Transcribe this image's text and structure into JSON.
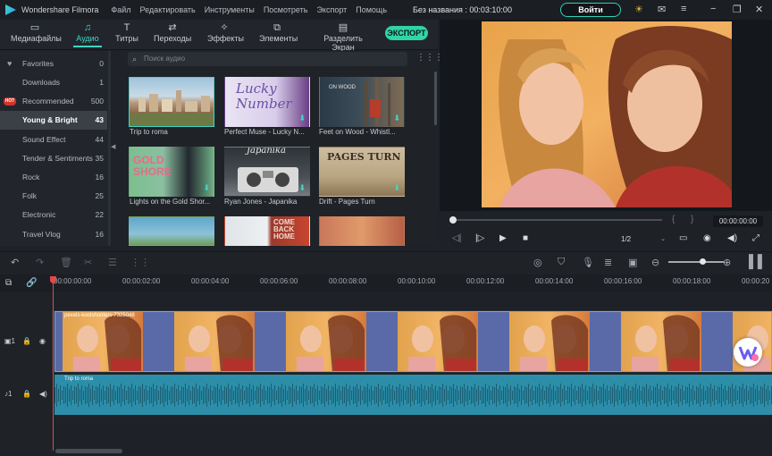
{
  "app": {
    "name": "Wondershare Filmora",
    "project": "Без названия : 00:03:10:00",
    "login": "Войти"
  },
  "menu": [
    "Файл",
    "Редактировать",
    "Инструменты",
    "Посмотреть",
    "Экспорт",
    "Помощь"
  ],
  "tabs": [
    {
      "label": "Медиафайлы",
      "icon": "folder-icon"
    },
    {
      "label": "Аудио",
      "icon": "music-note-icon",
      "active": true
    },
    {
      "label": "Титры",
      "icon": "text-icon"
    },
    {
      "label": "Переходы",
      "icon": "transition-icon"
    },
    {
      "label": "Эффекты",
      "icon": "effects-icon"
    },
    {
      "label": "Элементы",
      "icon": "elements-icon"
    },
    {
      "label": "Разделить Экран",
      "icon": "split-screen-icon"
    }
  ],
  "export_label": "ЭКСПОРТ",
  "sidebar": [
    {
      "label": "Favorites",
      "count": "0"
    },
    {
      "label": "Downloads",
      "count": "1"
    },
    {
      "label": "Recommended",
      "count": "500",
      "badge": "HOT"
    },
    {
      "label": "Young & Bright",
      "count": "43"
    },
    {
      "label": "Sound Effect",
      "count": "44"
    },
    {
      "label": "Tender & Sentiments",
      "count": "35"
    },
    {
      "label": "Rock",
      "count": "16"
    },
    {
      "label": "Folk",
      "count": "25"
    },
    {
      "label": "Electronic",
      "count": "22"
    },
    {
      "label": "Travel Vlog",
      "count": "16"
    }
  ],
  "search_placeholder": "Поиск аудио",
  "audio_items": [
    {
      "title": "Trip to roma"
    },
    {
      "title": "Perfect Muse - Lucky N...",
      "art_text": "Lucky Number"
    },
    {
      "title": "Feet on Wood - Whistl...",
      "art_text": "ON WOOD"
    },
    {
      "title": "Lights on the Gold Shor...",
      "art_text": "GOLD SHORE"
    },
    {
      "title": "Ryan Jones - Japanika",
      "art_text": "Japanika"
    },
    {
      "title": "Drift - Pages Turn",
      "art_text": "PAGES TURN"
    },
    {
      "title": ""
    },
    {
      "title": "",
      "art_text": "COME BACK HOME"
    },
    {
      "title": ""
    }
  ],
  "preview": {
    "time": "00:00:00:00",
    "quality": "1/2"
  },
  "ruler": [
    "00:00:00:00",
    "00:00:02:00",
    "00:00:04:00",
    "00:00:06:00",
    "00:00:08:00",
    "00:00:10:00",
    "00:00:12:00",
    "00:00:14:00",
    "00:00:16:00",
    "00:00:18:00",
    "00:00:20"
  ],
  "timeline": {
    "video_clip": "pexels-koolshooters-7325048",
    "audio_clip": "Trip to roma"
  },
  "colors": {
    "accent": "#3fd6c3",
    "export": "#30d4a6",
    "playhead": "#e04a4a",
    "audio_clip": "#2c8ea9",
    "video_clip_bg": "#5a6aa8"
  }
}
